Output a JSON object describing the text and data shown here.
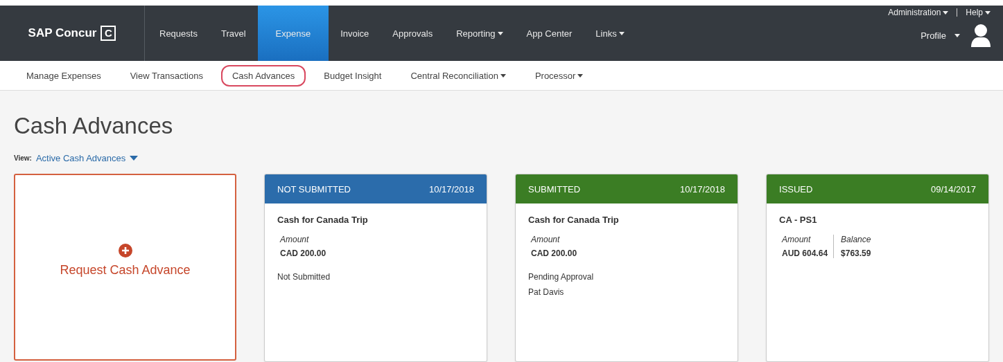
{
  "brand": {
    "name": "SAP Concur",
    "mark": "C"
  },
  "top_links": [
    {
      "label": "Administration",
      "dropdown": true
    },
    {
      "label": "Help",
      "dropdown": true
    }
  ],
  "profile": {
    "label": "Profile"
  },
  "nav": [
    {
      "label": "Requests",
      "selected": false,
      "dropdown": false
    },
    {
      "label": "Travel",
      "selected": false,
      "dropdown": false
    },
    {
      "label": "Expense",
      "selected": true,
      "dropdown": false
    },
    {
      "label": "Invoice",
      "selected": false,
      "dropdown": false
    },
    {
      "label": "Approvals",
      "selected": false,
      "dropdown": false
    },
    {
      "label": "Reporting",
      "selected": false,
      "dropdown": true
    },
    {
      "label": "App Center",
      "selected": false,
      "dropdown": false
    },
    {
      "label": "Links",
      "selected": false,
      "dropdown": true
    }
  ],
  "subnav": [
    {
      "label": "Manage Expenses",
      "selected": false,
      "dropdown": false
    },
    {
      "label": "View Transactions",
      "selected": false,
      "dropdown": false
    },
    {
      "label": "Cash Advances",
      "selected": true,
      "dropdown": false
    },
    {
      "label": "Budget Insight",
      "selected": false,
      "dropdown": false
    },
    {
      "label": "Central Reconciliation",
      "selected": false,
      "dropdown": true
    },
    {
      "label": "Processor",
      "selected": false,
      "dropdown": true
    }
  ],
  "page_title": "Cash Advances",
  "view": {
    "label": "View:",
    "value": "Active Cash Advances"
  },
  "request_tile": {
    "label": "Request Cash Advance"
  },
  "cards": [
    {
      "status": "NOT SUBMITTED",
      "date": "10/17/2018",
      "color": "#2b6cab",
      "title": "Cash for Canada Trip",
      "fields": [
        {
          "label": "Amount",
          "value": "CAD 200.00"
        }
      ],
      "notes": [
        "Not Submitted"
      ]
    },
    {
      "status": "SUBMITTED",
      "date": "10/17/2018",
      "color": "#3b7d24",
      "title": "Cash for Canada Trip",
      "fields": [
        {
          "label": "Amount",
          "value": "CAD 200.00"
        }
      ],
      "notes": [
        "Pending Approval",
        "Pat Davis"
      ]
    },
    {
      "status": "ISSUED",
      "date": "09/14/2017",
      "color": "#3b7d24",
      "title": "CA - PS1",
      "fields": [
        {
          "label": "Amount",
          "value": "AUD 604.64"
        },
        {
          "label": "Balance",
          "value": "$763.59"
        }
      ]
    }
  ]
}
